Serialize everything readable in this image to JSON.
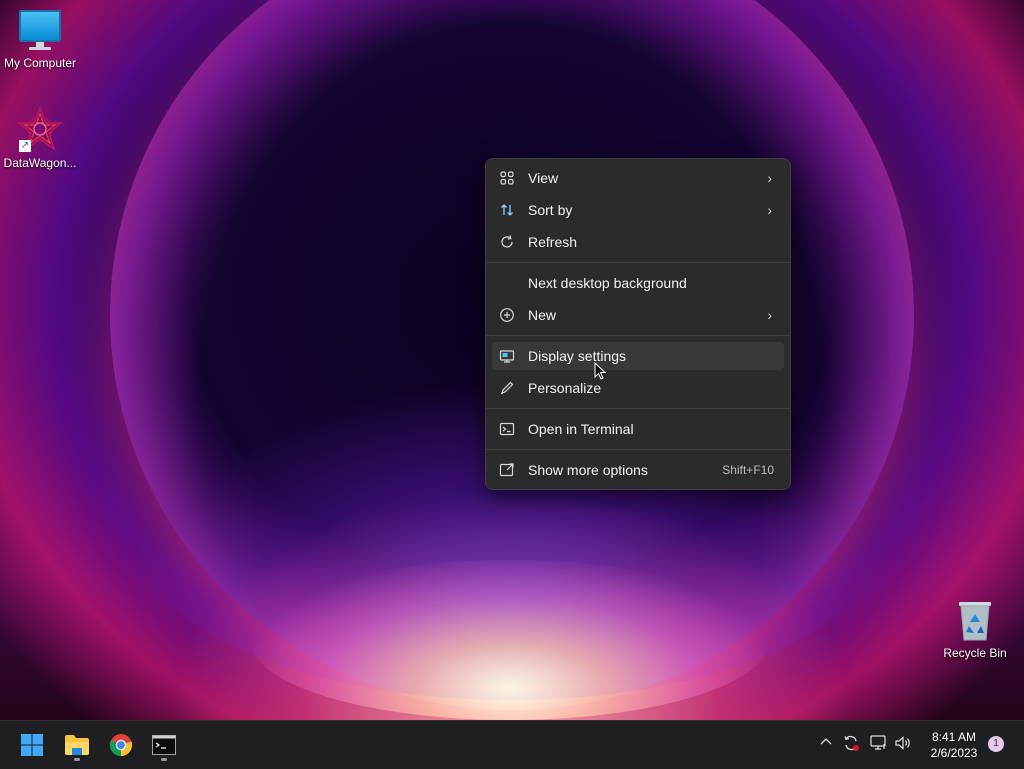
{
  "desktop": {
    "icons": [
      {
        "label": "My Computer",
        "icon": "computer-icon"
      },
      {
        "label": "DataWagon...",
        "icon": "datawagon-icon"
      },
      {
        "label": "Recycle Bin",
        "icon": "recycle-bin-icon"
      }
    ]
  },
  "context_menu": {
    "items": [
      {
        "label": "View",
        "icon": "grid-icon",
        "submenu": true
      },
      {
        "label": "Sort by",
        "icon": "sort-icon",
        "submenu": true
      },
      {
        "label": "Refresh",
        "icon": "refresh-icon",
        "submenu": false
      },
      {
        "label": "Next desktop background",
        "icon": "",
        "submenu": false
      },
      {
        "label": "New",
        "icon": "plus-circle-icon",
        "submenu": true
      },
      {
        "label": "Display settings",
        "icon": "display-icon",
        "submenu": false,
        "highlighted": true
      },
      {
        "label": "Personalize",
        "icon": "pen-icon",
        "submenu": false
      },
      {
        "label": "Open in Terminal",
        "icon": "terminal-icon",
        "submenu": false
      },
      {
        "label": "Show more options",
        "icon": "open-external-icon",
        "shortcut": "Shift+F10"
      }
    ]
  },
  "taskbar": {
    "apps": [
      {
        "name": "start",
        "icon": "windows-start-icon"
      },
      {
        "name": "file-explorer",
        "icon": "folder-icon",
        "running": true
      },
      {
        "name": "chrome",
        "icon": "chrome-icon",
        "running": false
      },
      {
        "name": "terminal",
        "icon": "terminal-icon",
        "running": true
      }
    ],
    "tray": {
      "time": "8:41 AM",
      "date": "2/6/2023",
      "notification_count": "1"
    }
  },
  "colors": {
    "menu_bg": "#2b2b2b",
    "menu_hover": "#383838",
    "taskbar_bg": "#1f1f22",
    "accent": "#4cc2ff"
  }
}
